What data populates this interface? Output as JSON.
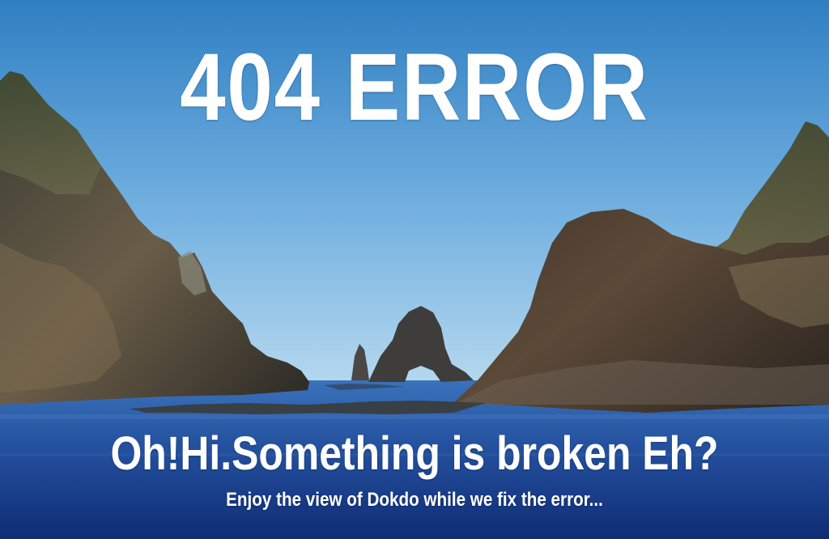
{
  "page": {
    "title": "404 ERROR",
    "subtitle": "Oh!Hi.Something is broken Eh?",
    "tagline": "Enjoy the view of Dokdo while we fix the error..."
  },
  "colors": {
    "sky_top": "#2f7fc3",
    "sky_bottom": "#a8d0ec",
    "sea_top": "#2e62ad",
    "sea_bottom": "#0f2f7a",
    "rock_dark": "#2e2a24",
    "rock_mid": "#5a4a3a",
    "text": "#ffffff"
  }
}
